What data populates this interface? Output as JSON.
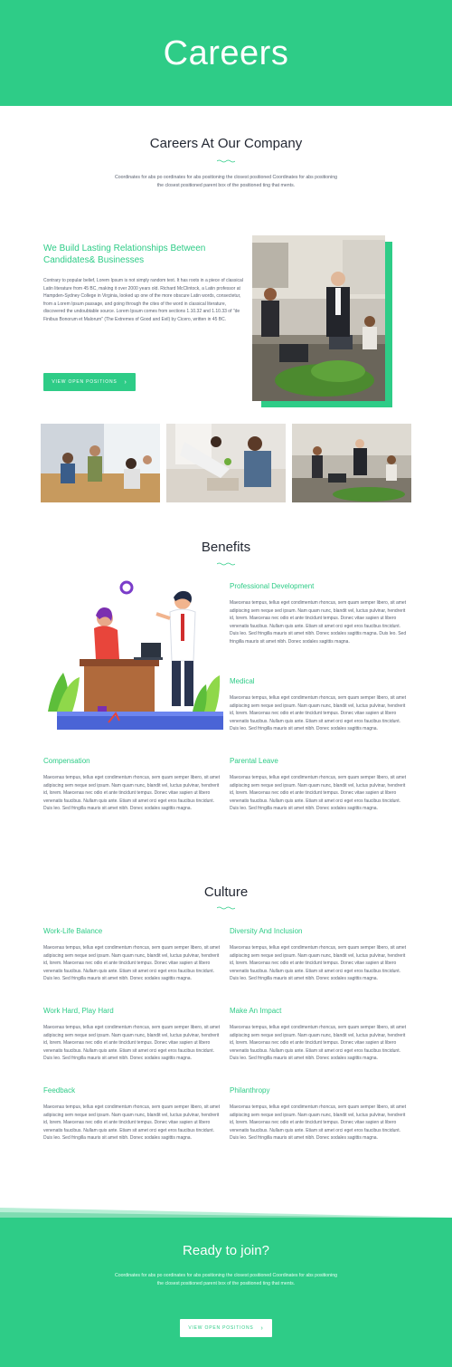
{
  "hero": {
    "title": "Careers"
  },
  "intro": {
    "heading": "Careers At Our Company",
    "text": "Coordinates for abs po oordinates for abs positioning the closest positioned Coordinates for abs positioning the closest positioned parent box of the positioned ting that ments."
  },
  "relationships": {
    "title": "We Build Lasting Relationships Between Candidates& Businesses",
    "body": "Contrary to popular belief, Lorem Ipsum is not simply random text. It has roots in a piece of classical Latin literature from 45 BC, making it over 2000 years old. Richard McClintock, a Latin professor at Hampden-Sydney College in Virginia, looked up one of the more obscure Latin words, consectetur, from a Lorem Ipsum passage, and going through the cites of the word in classical literature, discovered the undoubtable source. Lorem Ipsum comes from sections 1.10.32 and 1.10.33 of \"de Finibus Bonorum et Malorum\" (The Extremes of Good and Evil) by Cicero, written in 45 BC.",
    "button": "VIEW OPEN POSITIONS",
    "button_icon": "›"
  },
  "benefits": {
    "heading": "Benefits",
    "items": [
      {
        "title": "Professional Development",
        "text": "Maecenas tempus, tellus eget condimentum rhoncus, sem quam semper libero, sit amet adipiscing sem neque sed ipsum. Nam quam nunc, blandit vel, luctus pulvinar, hendrerit id, lorem. Maecenas nec odio et ante tincidunt tempus. Donec vitae sapien ut libero venenatis faucibus. Nullam quis ante. Etiam sit amet orci eget eros faucibus tincidunt. Duis leo. Sed fringilla mauris sit amet nibh. Donec sodales sagittis magna. Duis leo. Sed fringilla mauris sit amet nibh. Donec sodales sagittis magna."
      },
      {
        "title": "Medical",
        "text": "Maecenas tempus, tellus eget condimentum rhoncus, sem quam semper libero, sit amet adipiscing sem neque sed ipsum. Nam quam nunc, blandit vel, luctus pulvinar, hendrerit id, lorem. Maecenas nec odio et ante tincidunt tempus. Donec vitae sapien ut libero venenatis faucibus. Nullam quis ante. Etiam sit amet orci eget eros faucibus tincidunt. Duis leo. Sed fringilla mauris sit amet nibh. Donec sodales sagittis magna."
      },
      {
        "title": "Compensation",
        "text": "Maecenas tempus, tellus eget condimentum rhoncus, sem quam semper libero, sit amet adipiscing sem neque sed ipsum. Nam quam nunc, blandit vel, luctus pulvinar, hendrerit id, lorem. Maecenas nec odio et ante tincidunt tempus. Donec vitae sapien ut libero venenatis faucibus. Nullam quis ante. Etiam sit amet orci eget eros faucibus tincidunt. Duis leo. Sed fringilla mauris sit amet nibh. Donec sodales sagittis magna."
      },
      {
        "title": "Parental Leave",
        "text": "Maecenas tempus, tellus eget condimentum rhoncus, sem quam semper libero, sit amet adipiscing sem neque sed ipsum. Nam quam nunc, blandit vel, luctus pulvinar, hendrerit id, lorem. Maecenas nec odio et ante tincidunt tempus. Donec vitae sapien ut libero venenatis faucibus. Nullam quis ante. Etiam sit amet orci eget eros faucibus tincidunt. Duis leo. Sed fringilla mauris sit amet nibh. Donec sodales sagittis magna."
      }
    ]
  },
  "culture": {
    "heading": "Culture",
    "items": [
      {
        "title": "Work-Life Balance",
        "text": "Maecenas tempus, tellus eget condimentum rhoncus, sem quam semper libero, sit amet adipiscing sem neque sed ipsum. Nam quam nunc, blandit vel, luctus pulvinar, hendrerit id, lorem. Maecenas nec odio et ante tincidunt tempus. Donec vitae sapien ut libero venenatis faucibus. Nullam quis ante. Etiam sit amet orci eget eros faucibus tincidunt. Duis leo. Sed fringilla mauris sit amet nibh. Donec sodales sagittis magna."
      },
      {
        "title": "Diversity And Inclusion",
        "text": "Maecenas tempus, tellus eget condimentum rhoncus, sem quam semper libero, sit amet adipiscing sem neque sed ipsum. Nam quam nunc, blandit vel, luctus pulvinar, hendrerit id, lorem. Maecenas nec odio et ante tincidunt tempus. Donec vitae sapien ut libero venenatis faucibus. Nullam quis ante. Etiam sit amet orci eget eros faucibus tincidunt. Duis leo. Sed fringilla mauris sit amet nibh. Donec sodales sagittis magna."
      },
      {
        "title": "Work Hard, Play Hard",
        "text": "Maecenas tempus, tellus eget condimentum rhoncus, sem quam semper libero, sit amet adipiscing sem neque sed ipsum. Nam quam nunc, blandit vel, luctus pulvinar, hendrerit id, lorem. Maecenas nec odio et ante tincidunt tempus. Donec vitae sapien ut libero venenatis faucibus. Nullam quis ante. Etiam sit amet orci eget eros faucibus tincidunt. Duis leo. Sed fringilla mauris sit amet nibh. Donec sodales sagittis magna."
      },
      {
        "title": "Make An Impact",
        "text": "Maecenas tempus, tellus eget condimentum rhoncus, sem quam semper libero, sit amet adipiscing sem neque sed ipsum. Nam quam nunc, blandit vel, luctus pulvinar, hendrerit id, lorem. Maecenas nec odio et ante tincidunt tempus. Donec vitae sapien ut libero venenatis faucibus. Nullam quis ante. Etiam sit amet orci eget eros faucibus tincidunt. Duis leo. Sed fringilla mauris sit amet nibh. Donec sodales sagittis magna."
      },
      {
        "title": "Feedback",
        "text": "Maecenas tempus, tellus eget condimentum rhoncus, sem quam semper libero, sit amet adipiscing sem neque sed ipsum. Nam quam nunc, blandit vel, luctus pulvinar, hendrerit id, lorem. Maecenas nec odio et ante tincidunt tempus. Donec vitae sapien ut libero venenatis faucibus. Nullam quis ante. Etiam sit amet orci eget eros faucibus tincidunt. Duis leo. Sed fringilla mauris sit amet nibh. Donec sodales sagittis magna."
      },
      {
        "title": "Philanthropy",
        "text": "Maecenas tempus, tellus eget condimentum rhoncus, sem quam semper libero, sit amet adipiscing sem neque sed ipsum. Nam quam nunc, blandit vel, luctus pulvinar, hendrerit id, lorem. Maecenas nec odio et ante tincidunt tempus. Donec vitae sapien ut libero venenatis faucibus. Nullam quis ante. Etiam sit amet orci eget eros faucibus tincidunt. Duis leo. Sed fringilla mauris sit amet nibh. Donec sodales sagittis magna."
      }
    ]
  },
  "cta": {
    "heading": "Ready to join?",
    "text": "Coordinates for abs po oordinates for abs positioning the closest positioned Coordinates for abs positioning the closest positioned parent box of the positioned ting that ments.",
    "button": "VIEW OPEN POSITIONS",
    "button_icon": "›"
  },
  "colors": {
    "accent": "#2ecc87",
    "heading": "#232833",
    "body": "#5a6170"
  }
}
